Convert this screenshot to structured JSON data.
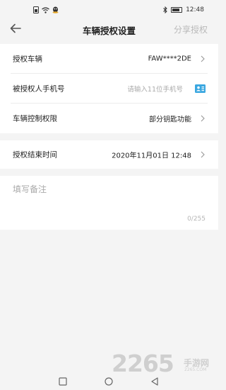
{
  "status_bar": {
    "left_icons": [
      "sim-icon",
      "wifi-icon",
      "qq-icon"
    ],
    "right_icons": [
      "bluetooth-icon",
      "battery-icon"
    ],
    "time": "12:48"
  },
  "header": {
    "title": "车辆授权设置",
    "share_label": "分享授权"
  },
  "form": {
    "vehicle": {
      "label": "授权车辆",
      "value": "FAW****2DE"
    },
    "phone": {
      "label": "被授权人手机号",
      "placeholder": "请输入11位手机号",
      "value": ""
    },
    "control": {
      "label": "车辆控制权限",
      "value": "部分钥匙功能"
    },
    "end_time": {
      "label": "授权结束时间",
      "value": "2020年11月01日 12:48"
    },
    "remark": {
      "placeholder": "填写备注",
      "counter": "0/255"
    }
  },
  "watermark": {
    "number": "2265",
    "text": "手游网",
    "url": "2265.COM"
  },
  "colors": {
    "accent": "#3aa7e0",
    "placeholder": "#aaaaaa",
    "background": "#f4f4f4"
  }
}
